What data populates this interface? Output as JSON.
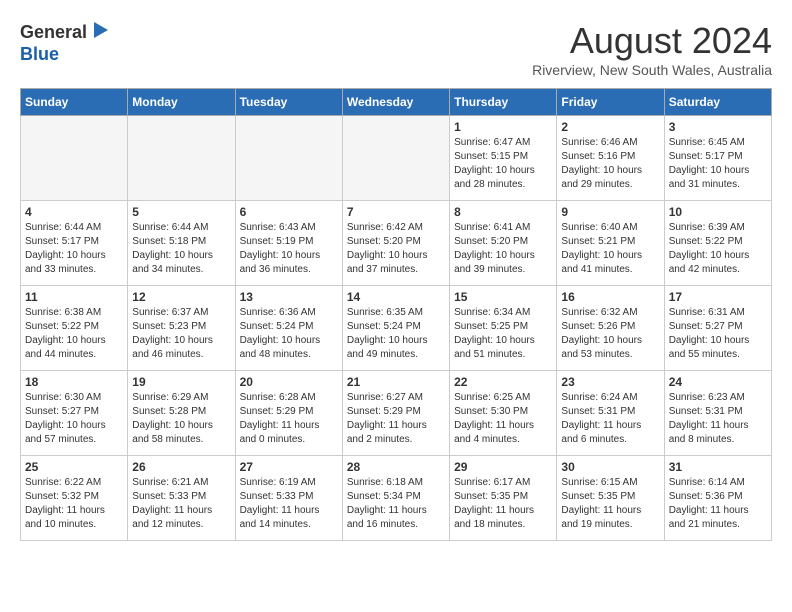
{
  "logo": {
    "line1": "General",
    "line2": "Blue"
  },
  "title": "August 2024",
  "subtitle": "Riverview, New South Wales, Australia",
  "days_of_week": [
    "Sunday",
    "Monday",
    "Tuesday",
    "Wednesday",
    "Thursday",
    "Friday",
    "Saturday"
  ],
  "weeks": [
    [
      {
        "day": "",
        "info": "",
        "empty": true
      },
      {
        "day": "",
        "info": "",
        "empty": true
      },
      {
        "day": "",
        "info": "",
        "empty": true
      },
      {
        "day": "",
        "info": "",
        "empty": true
      },
      {
        "day": "1",
        "info": "Sunrise: 6:47 AM\nSunset: 5:15 PM\nDaylight: 10 hours\nand 28 minutes."
      },
      {
        "day": "2",
        "info": "Sunrise: 6:46 AM\nSunset: 5:16 PM\nDaylight: 10 hours\nand 29 minutes."
      },
      {
        "day": "3",
        "info": "Sunrise: 6:45 AM\nSunset: 5:17 PM\nDaylight: 10 hours\nand 31 minutes."
      }
    ],
    [
      {
        "day": "4",
        "info": "Sunrise: 6:44 AM\nSunset: 5:17 PM\nDaylight: 10 hours\nand 33 minutes."
      },
      {
        "day": "5",
        "info": "Sunrise: 6:44 AM\nSunset: 5:18 PM\nDaylight: 10 hours\nand 34 minutes."
      },
      {
        "day": "6",
        "info": "Sunrise: 6:43 AM\nSunset: 5:19 PM\nDaylight: 10 hours\nand 36 minutes."
      },
      {
        "day": "7",
        "info": "Sunrise: 6:42 AM\nSunset: 5:20 PM\nDaylight: 10 hours\nand 37 minutes."
      },
      {
        "day": "8",
        "info": "Sunrise: 6:41 AM\nSunset: 5:20 PM\nDaylight: 10 hours\nand 39 minutes."
      },
      {
        "day": "9",
        "info": "Sunrise: 6:40 AM\nSunset: 5:21 PM\nDaylight: 10 hours\nand 41 minutes."
      },
      {
        "day": "10",
        "info": "Sunrise: 6:39 AM\nSunset: 5:22 PM\nDaylight: 10 hours\nand 42 minutes."
      }
    ],
    [
      {
        "day": "11",
        "info": "Sunrise: 6:38 AM\nSunset: 5:22 PM\nDaylight: 10 hours\nand 44 minutes."
      },
      {
        "day": "12",
        "info": "Sunrise: 6:37 AM\nSunset: 5:23 PM\nDaylight: 10 hours\nand 46 minutes."
      },
      {
        "day": "13",
        "info": "Sunrise: 6:36 AM\nSunset: 5:24 PM\nDaylight: 10 hours\nand 48 minutes."
      },
      {
        "day": "14",
        "info": "Sunrise: 6:35 AM\nSunset: 5:24 PM\nDaylight: 10 hours\nand 49 minutes."
      },
      {
        "day": "15",
        "info": "Sunrise: 6:34 AM\nSunset: 5:25 PM\nDaylight: 10 hours\nand 51 minutes."
      },
      {
        "day": "16",
        "info": "Sunrise: 6:32 AM\nSunset: 5:26 PM\nDaylight: 10 hours\nand 53 minutes."
      },
      {
        "day": "17",
        "info": "Sunrise: 6:31 AM\nSunset: 5:27 PM\nDaylight: 10 hours\nand 55 minutes."
      }
    ],
    [
      {
        "day": "18",
        "info": "Sunrise: 6:30 AM\nSunset: 5:27 PM\nDaylight: 10 hours\nand 57 minutes."
      },
      {
        "day": "19",
        "info": "Sunrise: 6:29 AM\nSunset: 5:28 PM\nDaylight: 10 hours\nand 58 minutes."
      },
      {
        "day": "20",
        "info": "Sunrise: 6:28 AM\nSunset: 5:29 PM\nDaylight: 11 hours\nand 0 minutes."
      },
      {
        "day": "21",
        "info": "Sunrise: 6:27 AM\nSunset: 5:29 PM\nDaylight: 11 hours\nand 2 minutes."
      },
      {
        "day": "22",
        "info": "Sunrise: 6:25 AM\nSunset: 5:30 PM\nDaylight: 11 hours\nand 4 minutes."
      },
      {
        "day": "23",
        "info": "Sunrise: 6:24 AM\nSunset: 5:31 PM\nDaylight: 11 hours\nand 6 minutes."
      },
      {
        "day": "24",
        "info": "Sunrise: 6:23 AM\nSunset: 5:31 PM\nDaylight: 11 hours\nand 8 minutes."
      }
    ],
    [
      {
        "day": "25",
        "info": "Sunrise: 6:22 AM\nSunset: 5:32 PM\nDaylight: 11 hours\nand 10 minutes."
      },
      {
        "day": "26",
        "info": "Sunrise: 6:21 AM\nSunset: 5:33 PM\nDaylight: 11 hours\nand 12 minutes."
      },
      {
        "day": "27",
        "info": "Sunrise: 6:19 AM\nSunset: 5:33 PM\nDaylight: 11 hours\nand 14 minutes."
      },
      {
        "day": "28",
        "info": "Sunrise: 6:18 AM\nSunset: 5:34 PM\nDaylight: 11 hours\nand 16 minutes."
      },
      {
        "day": "29",
        "info": "Sunrise: 6:17 AM\nSunset: 5:35 PM\nDaylight: 11 hours\nand 18 minutes."
      },
      {
        "day": "30",
        "info": "Sunrise: 6:15 AM\nSunset: 5:35 PM\nDaylight: 11 hours\nand 19 minutes."
      },
      {
        "day": "31",
        "info": "Sunrise: 6:14 AM\nSunset: 5:36 PM\nDaylight: 11 hours\nand 21 minutes."
      }
    ]
  ]
}
